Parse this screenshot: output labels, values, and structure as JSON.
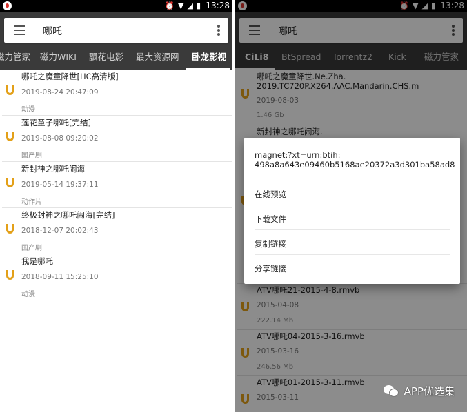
{
  "status_bar": {
    "time": "13:28",
    "icons": [
      "alarm-icon",
      "wifi-icon",
      "signal-icon",
      "battery-icon"
    ]
  },
  "search": {
    "query": "哪吒"
  },
  "left": {
    "tabs": [
      {
        "label": "磁力管家",
        "active": false
      },
      {
        "label": "磁力WIKI",
        "active": false
      },
      {
        "label": "飘花电影",
        "active": false
      },
      {
        "label": "最大资源网",
        "active": false
      },
      {
        "label": "卧龙影视",
        "active": true
      }
    ],
    "items": [
      {
        "title": "哪吒之魔童降世[HC高清版]",
        "date": "2019-08-24 20:47:09",
        "category": "动漫"
      },
      {
        "title": "莲花童子哪吒[完结]",
        "date": "2019-08-08 09:20:02",
        "category": "国产剧"
      },
      {
        "title": "新封神之哪吒闹海",
        "date": "2019-05-14 19:37:11",
        "category": "动作片"
      },
      {
        "title": "终极封神之哪吒闹海[完结]",
        "date": "2018-12-07 20:02:43",
        "category": "国产剧"
      },
      {
        "title": "我是哪吒",
        "date": "2018-09-11 15:25:10",
        "category": "动漫"
      }
    ]
  },
  "right": {
    "tabs": [
      {
        "label": "CiLi8",
        "active": true
      },
      {
        "label": "BtSpread",
        "active": false
      },
      {
        "label": "Torrentz2",
        "active": false
      },
      {
        "label": "Kick",
        "active": false
      },
      {
        "label": "磁力管家",
        "active": false
      }
    ],
    "items": [
      {
        "title": "哪吒之魔童降世.Ne.Zha.\n2019.TC720P.X264.AAC.Mandarin.CHS.m",
        "date": "2019-08-03",
        "size": "1.46 Gb"
      },
      {
        "title": "新封神之哪吒闹海.",
        "date": "",
        "size": ""
      },
      {
        "title": "ATV哪吒21-2015-4-8.rmvb",
        "date": "2015-04-08",
        "size": "222.14 Mb"
      },
      {
        "title": "ATV哪吒04-2015-3-16.rmvb",
        "date": "2015-03-16",
        "size": "246.56 Mb"
      },
      {
        "title": "ATV哪吒01-2015-3-11.rmvb",
        "date": "2015-03-11",
        "size": ""
      }
    ],
    "dialog": {
      "title": "magnet:?xt=urn:btih:\n498a8a643e09460b5168ae20372a3d301ba58ad8",
      "options": [
        "在线预览",
        "下载文件",
        "复制链接",
        "分享链接"
      ]
    }
  },
  "watermark": {
    "text": "APP优选集"
  },
  "colors": {
    "appbar": "#3a3a3a",
    "magnet": "#e3a018",
    "overlay": "rgba(0,0,0,0.45)"
  }
}
